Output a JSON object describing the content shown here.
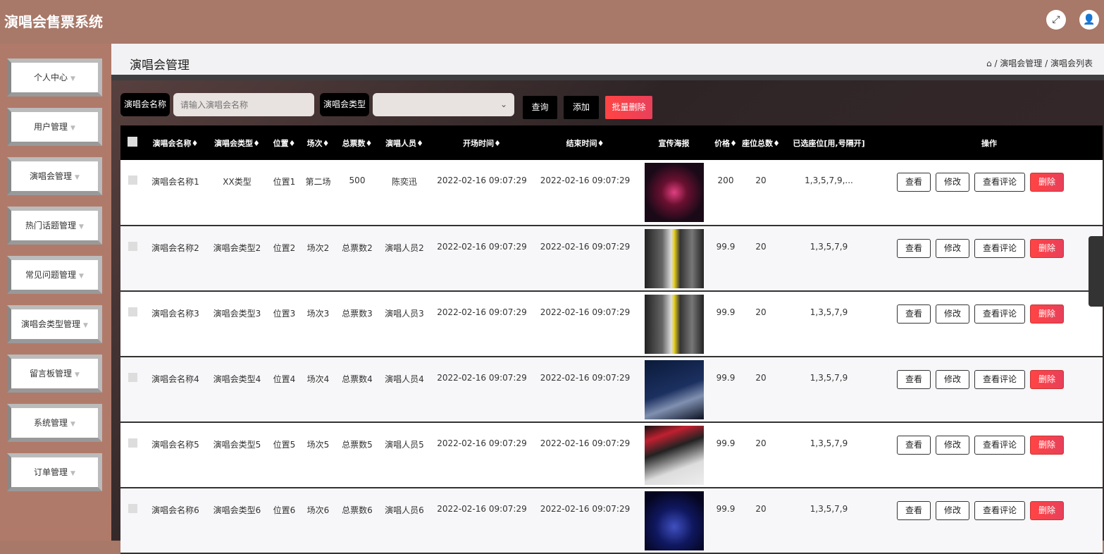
{
  "app": {
    "title": "演唱会售票系统",
    "icons": [
      "fullscreen-icon",
      "user-icon"
    ]
  },
  "sidebar": {
    "items": [
      "个人中心",
      "用户管理",
      "演唱会管理",
      "热门话题管理",
      "常见问题管理",
      "演唱会类型管理",
      "留言板管理",
      "系统管理",
      "订单管理"
    ]
  },
  "page": {
    "title": "演唱会管理",
    "breadcrumb": [
      "演唱会管理",
      "演唱会列表"
    ]
  },
  "search": {
    "name_label": "演唱会名称",
    "name_placeholder": "请输入演唱会名称",
    "type_label": "演唱会类型",
    "type_value": "",
    "query": "查询",
    "add": "添加",
    "batch_delete": "批量删除"
  },
  "table": {
    "headers": [
      "演唱会名称",
      "演唱会类型",
      "位置",
      "场次",
      "总票数",
      "演唱人员",
      "开场时间",
      "结束时间",
      "宣传海报",
      "价格",
      "座位总数",
      "已选座位[用,号隔开]",
      "操作"
    ],
    "sort_mark": "♦",
    "actions": {
      "view": "查看",
      "edit": "修改",
      "comments": "查看评论",
      "delete": "删除"
    },
    "rows": [
      {
        "name": "演唱会名称1",
        "type": "XX类型",
        "location": "位置1",
        "session": "第二场",
        "total": "500",
        "performer": "陈奕迅",
        "start": "2022-02-16 09:07:29",
        "end": "2022-02-16 09:07:29",
        "price": "200",
        "seats": "20",
        "selected": "1,3,5,7,9,..."
      },
      {
        "name": "演唱会名称2",
        "type": "演唱会类型2",
        "location": "位置2",
        "session": "场次2",
        "total": "总票数2",
        "performer": "演唱人员2",
        "start": "2022-02-16 09:07:29",
        "end": "2022-02-16 09:07:29",
        "price": "99.9",
        "seats": "20",
        "selected": "1,3,5,7,9"
      },
      {
        "name": "演唱会名称3",
        "type": "演唱会类型3",
        "location": "位置3",
        "session": "场次3",
        "total": "总票数3",
        "performer": "演唱人员3",
        "start": "2022-02-16 09:07:29",
        "end": "2022-02-16 09:07:29",
        "price": "99.9",
        "seats": "20",
        "selected": "1,3,5,7,9"
      },
      {
        "name": "演唱会名称4",
        "type": "演唱会类型4",
        "location": "位置4",
        "session": "场次4",
        "total": "总票数4",
        "performer": "演唱人员4",
        "start": "2022-02-16 09:07:29",
        "end": "2022-02-16 09:07:29",
        "price": "99.9",
        "seats": "20",
        "selected": "1,3,5,7,9"
      },
      {
        "name": "演唱会名称5",
        "type": "演唱会类型5",
        "location": "位置5",
        "session": "场次5",
        "total": "总票数5",
        "performer": "演唱人员5",
        "start": "2022-02-16 09:07:29",
        "end": "2022-02-16 09:07:29",
        "price": "99.9",
        "seats": "20",
        "selected": "1,3,5,7,9"
      },
      {
        "name": "演唱会名称6",
        "type": "演唱会类型6",
        "location": "位置6",
        "session": "场次6",
        "total": "总票数6",
        "performer": "演唱人员6",
        "start": "2022-02-16 09:07:29",
        "end": "2022-02-16 09:07:29",
        "price": "99.9",
        "seats": "20",
        "selected": "1,3,5,7,9"
      }
    ]
  },
  "colors": {
    "header_bg": "#a87868",
    "delete": "#ff4444",
    "table_header": "#000000"
  }
}
